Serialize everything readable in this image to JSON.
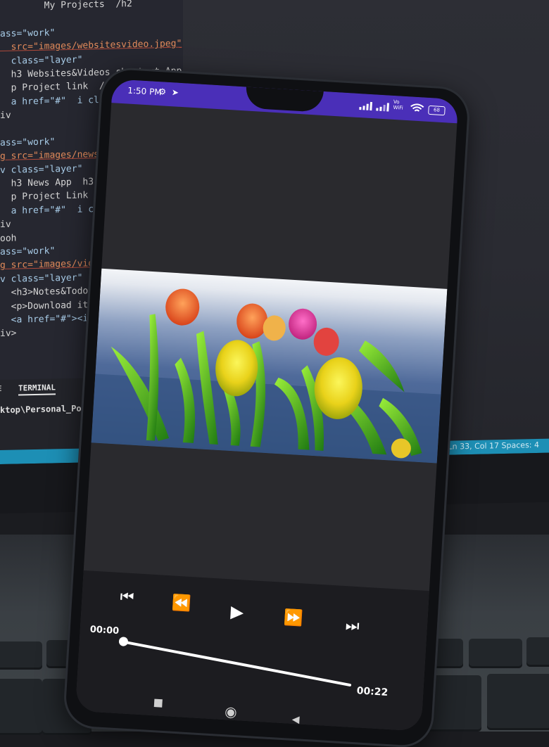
{
  "editor": {
    "lines": [
      {
        "t": "        My Projects  /h2",
        "k": "tag"
      },
      {
        "t": "",
        "k": "tag"
      },
      {
        "t": "ass=\"work\"",
        "k": "attr"
      },
      {
        "t": "  src=\"images/websitesvideo.jpeg\"",
        "k": "str"
      },
      {
        "t": "  class=\"layer\"",
        "k": "attr"
      },
      {
        "t": "  h3 Websites&Videos shortcut App  h3",
        "k": "tag"
      },
      {
        "t": "  p Project link  /p",
        "k": "tag"
      },
      {
        "t": "  a href=\"#\"  i class=\"fa-sol",
        "k": "attr"
      },
      {
        "t": "iv",
        "k": "tag"
      },
      {
        "t": "",
        "k": "tag"
      },
      {
        "t": "ass=\"work\"",
        "k": "attr"
      },
      {
        "t": "g src=\"images/newsapp.jpeg\"",
        "k": "str"
      },
      {
        "t": "v class=\"layer\"",
        "k": "attr"
      },
      {
        "t": "  h3 News App  h3",
        "k": "tag"
      },
      {
        "t": "  p Project Link  p",
        "k": "tag"
      },
      {
        "t": "  a href=\"#\"  i class=\"fa-",
        "k": "attr"
      },
      {
        "t": "iv",
        "k": "tag"
      },
      {
        "t": "ooh",
        "k": "tag"
      },
      {
        "t": "ass=\"work\"",
        "k": "attr"
      },
      {
        "t": "g src=\"images/videoplayer",
        "k": "str"
      },
      {
        "t": "v class=\"layer\"",
        "k": "attr"
      },
      {
        "t": "  <h3>Notes&Todos App</h3",
        "k": "tag"
      },
      {
        "t": "  <p>Download it from pl",
        "k": "tag"
      },
      {
        "t": "  <a href=\"#\"><i class=\"",
        "k": "attr"
      },
      {
        "t": "iv>",
        "k": "tag"
      }
    ],
    "panel_tab_dim": "E",
    "panel_tab_terminal": "TERMINAL",
    "terminal_path": "ktop\\Personal_Portfolio"
  },
  "statusbar": {
    "text": "Ln 33, Col 17    Spaces: 4"
  },
  "phone": {
    "status": {
      "time": "1:50 PM",
      "left_icons": "⚙ ➤",
      "volte": "Vo\nWiFi",
      "battery": "68"
    },
    "player": {
      "current_time": "00:00",
      "total_time": "00:22",
      "progress": 0.0,
      "buttons": {
        "prev": "⏮",
        "rewind": "⏪",
        "play": "▶",
        "forward": "⏩",
        "next": "⏭"
      }
    },
    "nav": {
      "recents": "■",
      "home": "◉",
      "back": "◀"
    }
  },
  "colors": {
    "status_bar": "#4a2fb8",
    "vscode_status": "#1d8fb5",
    "screen_bg": "#2a2a2e"
  }
}
